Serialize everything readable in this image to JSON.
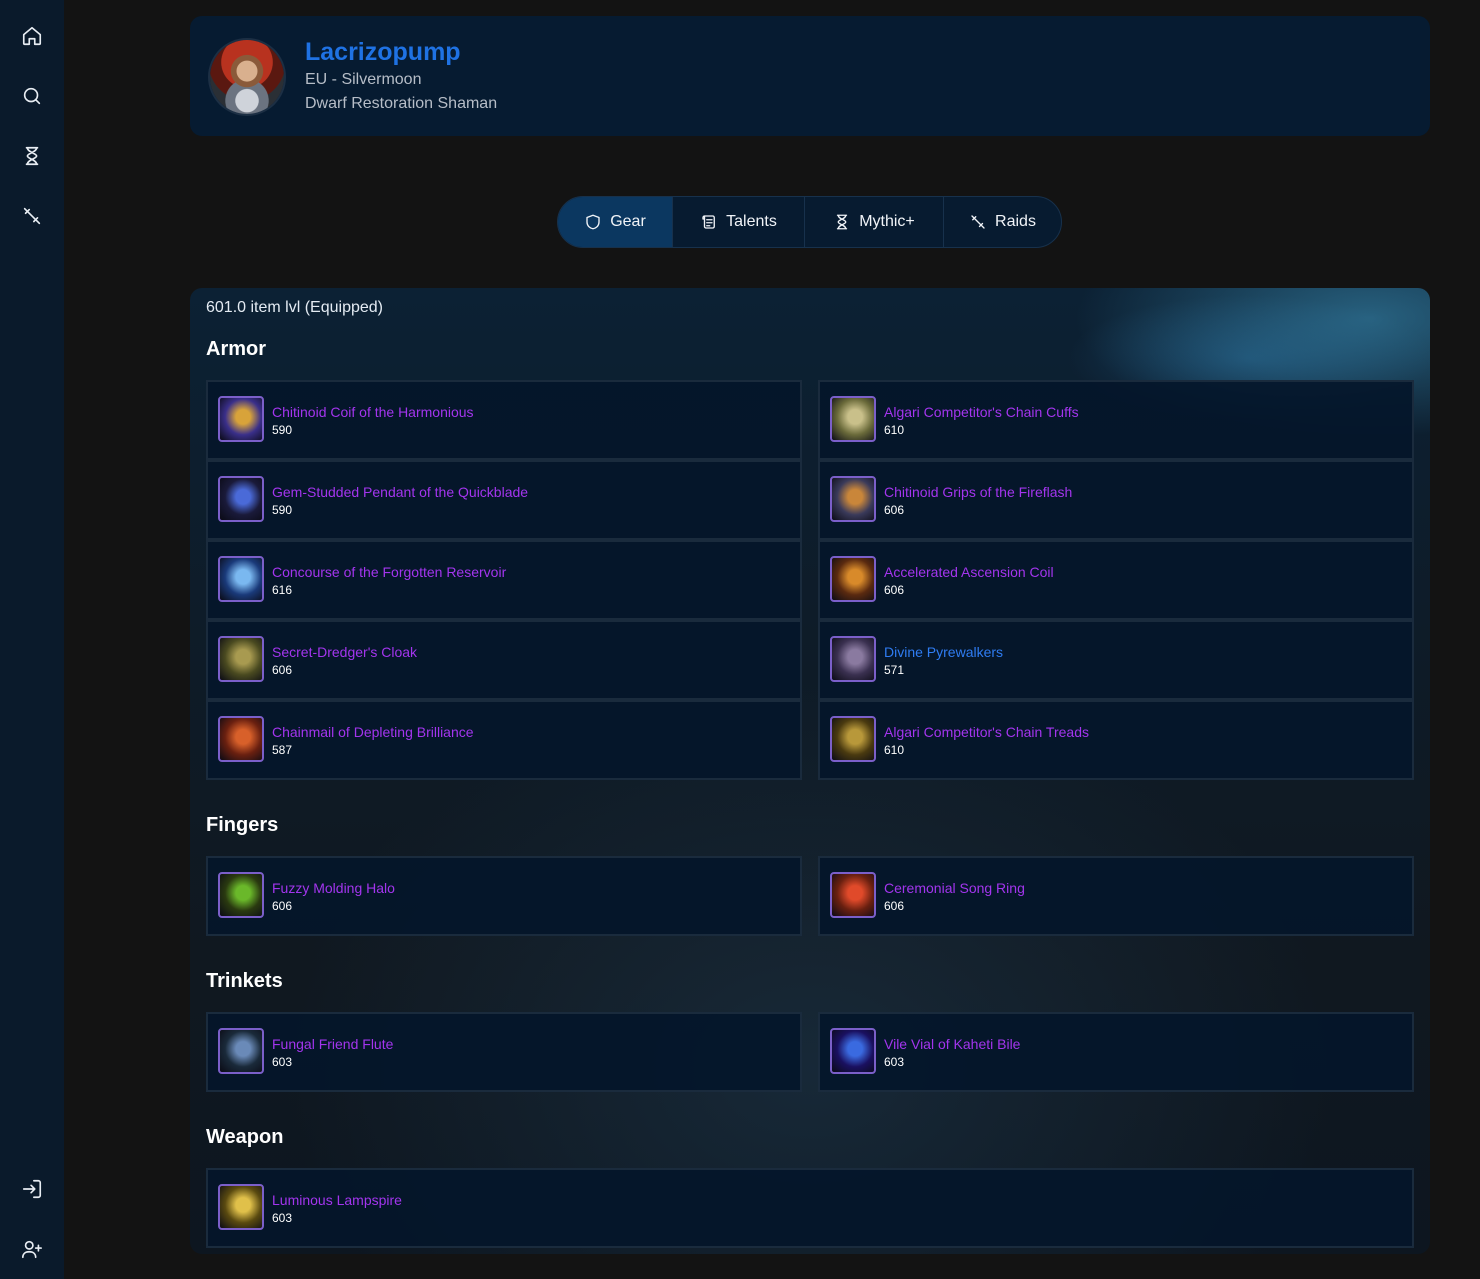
{
  "character": {
    "name": "Lacrizopump",
    "realm": "EU - Silvermoon",
    "spec": "Dwarf Restoration Shaman"
  },
  "tabs": [
    {
      "label": "Gear",
      "icon": "shield-icon",
      "active": true
    },
    {
      "label": "Talents",
      "icon": "scroll-icon",
      "active": false
    },
    {
      "label": "Mythic+",
      "icon": "hourglass-icon",
      "active": false
    },
    {
      "label": "Raids",
      "icon": "sword-icon",
      "active": false
    }
  ],
  "sidebar": [
    "home-icon",
    "search-icon",
    "hourglass-icon",
    "sword-icon",
    "login-icon",
    "add-user-icon"
  ],
  "gear": {
    "item_level": "601.0 item lvl (Equipped)",
    "sections": {
      "armor": "Armor",
      "fingers": "Fingers",
      "trinkets": "Trinkets",
      "weapon": "Weapon"
    },
    "armor": [
      {
        "name": "Chitinoid Coif of the Harmonious",
        "ilvl": "590",
        "quality": "epic",
        "icon_colors": [
          "#3a2f8a",
          "#d8a33a"
        ]
      },
      {
        "name": "Algari Competitor's Chain Cuffs",
        "ilvl": "610",
        "quality": "epic",
        "icon_colors": [
          "#6a6a3a",
          "#c9c08a"
        ]
      },
      {
        "name": "Gem-Studded Pendant of the Quickblade",
        "ilvl": "590",
        "quality": "epic",
        "icon_colors": [
          "#1a1a3a",
          "#4a6ad8"
        ]
      },
      {
        "name": "Chitinoid Grips of the Fireflash",
        "ilvl": "606",
        "quality": "epic",
        "icon_colors": [
          "#3a3a5a",
          "#c9863a"
        ]
      },
      {
        "name": "Concourse of the Forgotten Reservoir",
        "ilvl": "616",
        "quality": "epic",
        "icon_colors": [
          "#1a3a7a",
          "#7ab8f0"
        ]
      },
      {
        "name": "Accelerated Ascension Coil",
        "ilvl": "606",
        "quality": "epic",
        "icon_colors": [
          "#5a2a10",
          "#d88a2a"
        ]
      },
      {
        "name": "Secret-Dredger's Cloak",
        "ilvl": "606",
        "quality": "epic",
        "icon_colors": [
          "#4a4a20",
          "#a89a50"
        ]
      },
      {
        "name": "Divine Pyrewalkers",
        "ilvl": "571",
        "quality": "rare",
        "icon_colors": [
          "#3a3050",
          "#8a7aa0"
        ]
      },
      {
        "name": "Chainmail of Depleting Brilliance",
        "ilvl": "587",
        "quality": "epic",
        "icon_colors": [
          "#6a2010",
          "#d8602a"
        ]
      },
      {
        "name": "Algari Competitor's Chain Treads",
        "ilvl": "610",
        "quality": "epic",
        "icon_colors": [
          "#4a3a10",
          "#b8983a"
        ]
      }
    ],
    "fingers": [
      {
        "name": "Fuzzy Molding Halo",
        "ilvl": "606",
        "quality": "epic",
        "icon_colors": [
          "#2a3a10",
          "#6ab82a"
        ]
      },
      {
        "name": "Ceremonial Song Ring",
        "ilvl": "606",
        "quality": "epic",
        "icon_colors": [
          "#6a2010",
          "#e04a2a"
        ]
      }
    ],
    "trinkets": [
      {
        "name": "Fungal Friend Flute",
        "ilvl": "603",
        "quality": "epic",
        "icon_colors": [
          "#1a2a3a",
          "#6a8ab8"
        ]
      },
      {
        "name": "Vile Vial of Kaheti Bile",
        "ilvl": "603",
        "quality": "epic",
        "icon_colors": [
          "#1a1060",
          "#3a6ae0"
        ]
      }
    ],
    "weapon": [
      {
        "name": "Luminous Lampspire",
        "ilvl": "603",
        "quality": "epic",
        "icon_colors": [
          "#5a4a10",
          "#e0c04a"
        ]
      }
    ]
  },
  "colors": {
    "epic": "#a335ee",
    "rare": "#2f7cf2",
    "name_link": "#1f72e3",
    "panel_bg": "#061b31"
  }
}
